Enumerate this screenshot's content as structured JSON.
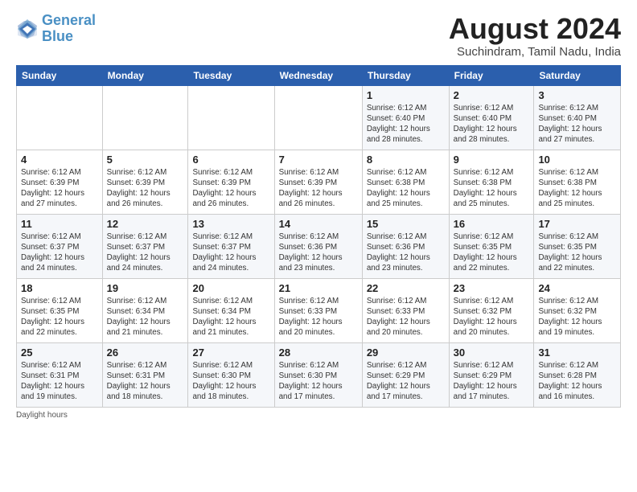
{
  "logo": {
    "line1": "General",
    "line2": "Blue"
  },
  "title": "August 2024",
  "subtitle": "Suchindram, Tamil Nadu, India",
  "days_of_week": [
    "Sunday",
    "Monday",
    "Tuesday",
    "Wednesday",
    "Thursday",
    "Friday",
    "Saturday"
  ],
  "footer": "Daylight hours",
  "weeks": [
    [
      {
        "day": "",
        "info": ""
      },
      {
        "day": "",
        "info": ""
      },
      {
        "day": "",
        "info": ""
      },
      {
        "day": "",
        "info": ""
      },
      {
        "day": "1",
        "info": "Sunrise: 6:12 AM\nSunset: 6:40 PM\nDaylight: 12 hours\nand 28 minutes."
      },
      {
        "day": "2",
        "info": "Sunrise: 6:12 AM\nSunset: 6:40 PM\nDaylight: 12 hours\nand 28 minutes."
      },
      {
        "day": "3",
        "info": "Sunrise: 6:12 AM\nSunset: 6:40 PM\nDaylight: 12 hours\nand 27 minutes."
      }
    ],
    [
      {
        "day": "4",
        "info": "Sunrise: 6:12 AM\nSunset: 6:39 PM\nDaylight: 12 hours\nand 27 minutes."
      },
      {
        "day": "5",
        "info": "Sunrise: 6:12 AM\nSunset: 6:39 PM\nDaylight: 12 hours\nand 26 minutes."
      },
      {
        "day": "6",
        "info": "Sunrise: 6:12 AM\nSunset: 6:39 PM\nDaylight: 12 hours\nand 26 minutes."
      },
      {
        "day": "7",
        "info": "Sunrise: 6:12 AM\nSunset: 6:39 PM\nDaylight: 12 hours\nand 26 minutes."
      },
      {
        "day": "8",
        "info": "Sunrise: 6:12 AM\nSunset: 6:38 PM\nDaylight: 12 hours\nand 25 minutes."
      },
      {
        "day": "9",
        "info": "Sunrise: 6:12 AM\nSunset: 6:38 PM\nDaylight: 12 hours\nand 25 minutes."
      },
      {
        "day": "10",
        "info": "Sunrise: 6:12 AM\nSunset: 6:38 PM\nDaylight: 12 hours\nand 25 minutes."
      }
    ],
    [
      {
        "day": "11",
        "info": "Sunrise: 6:12 AM\nSunset: 6:37 PM\nDaylight: 12 hours\nand 24 minutes."
      },
      {
        "day": "12",
        "info": "Sunrise: 6:12 AM\nSunset: 6:37 PM\nDaylight: 12 hours\nand 24 minutes."
      },
      {
        "day": "13",
        "info": "Sunrise: 6:12 AM\nSunset: 6:37 PM\nDaylight: 12 hours\nand 24 minutes."
      },
      {
        "day": "14",
        "info": "Sunrise: 6:12 AM\nSunset: 6:36 PM\nDaylight: 12 hours\nand 23 minutes."
      },
      {
        "day": "15",
        "info": "Sunrise: 6:12 AM\nSunset: 6:36 PM\nDaylight: 12 hours\nand 23 minutes."
      },
      {
        "day": "16",
        "info": "Sunrise: 6:12 AM\nSunset: 6:35 PM\nDaylight: 12 hours\nand 22 minutes."
      },
      {
        "day": "17",
        "info": "Sunrise: 6:12 AM\nSunset: 6:35 PM\nDaylight: 12 hours\nand 22 minutes."
      }
    ],
    [
      {
        "day": "18",
        "info": "Sunrise: 6:12 AM\nSunset: 6:35 PM\nDaylight: 12 hours\nand 22 minutes."
      },
      {
        "day": "19",
        "info": "Sunrise: 6:12 AM\nSunset: 6:34 PM\nDaylight: 12 hours\nand 21 minutes."
      },
      {
        "day": "20",
        "info": "Sunrise: 6:12 AM\nSunset: 6:34 PM\nDaylight: 12 hours\nand 21 minutes."
      },
      {
        "day": "21",
        "info": "Sunrise: 6:12 AM\nSunset: 6:33 PM\nDaylight: 12 hours\nand 20 minutes."
      },
      {
        "day": "22",
        "info": "Sunrise: 6:12 AM\nSunset: 6:33 PM\nDaylight: 12 hours\nand 20 minutes."
      },
      {
        "day": "23",
        "info": "Sunrise: 6:12 AM\nSunset: 6:32 PM\nDaylight: 12 hours\nand 20 minutes."
      },
      {
        "day": "24",
        "info": "Sunrise: 6:12 AM\nSunset: 6:32 PM\nDaylight: 12 hours\nand 19 minutes."
      }
    ],
    [
      {
        "day": "25",
        "info": "Sunrise: 6:12 AM\nSunset: 6:31 PM\nDaylight: 12 hours\nand 19 minutes."
      },
      {
        "day": "26",
        "info": "Sunrise: 6:12 AM\nSunset: 6:31 PM\nDaylight: 12 hours\nand 18 minutes."
      },
      {
        "day": "27",
        "info": "Sunrise: 6:12 AM\nSunset: 6:30 PM\nDaylight: 12 hours\nand 18 minutes."
      },
      {
        "day": "28",
        "info": "Sunrise: 6:12 AM\nSunset: 6:30 PM\nDaylight: 12 hours\nand 17 minutes."
      },
      {
        "day": "29",
        "info": "Sunrise: 6:12 AM\nSunset: 6:29 PM\nDaylight: 12 hours\nand 17 minutes."
      },
      {
        "day": "30",
        "info": "Sunrise: 6:12 AM\nSunset: 6:29 PM\nDaylight: 12 hours\nand 17 minutes."
      },
      {
        "day": "31",
        "info": "Sunrise: 6:12 AM\nSunset: 6:28 PM\nDaylight: 12 hours\nand 16 minutes."
      }
    ]
  ]
}
